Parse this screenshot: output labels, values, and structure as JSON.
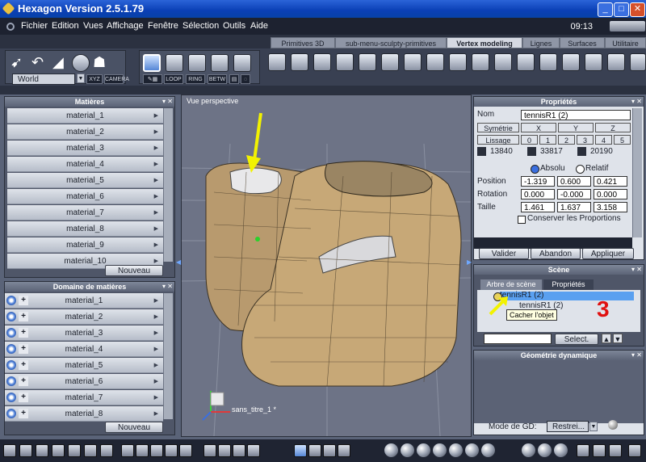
{
  "window": {
    "title": "Hexagon Version 2.5.1.79"
  },
  "menu": {
    "items": [
      "Fichier",
      "Edition",
      "Vues",
      "Affichage",
      "Fenêtre",
      "Sélection",
      "Outils",
      "Aide"
    ],
    "time": "09:13"
  },
  "tabs": [
    {
      "label": "Primitives 3D",
      "active": false
    },
    {
      "label": "sub-menu-sculpty-primitives",
      "active": false
    },
    {
      "label": "Vertex modeling",
      "active": true
    },
    {
      "label": "Lignes",
      "active": false
    },
    {
      "label": "Surfaces",
      "active": false
    },
    {
      "label": "Utilitaire",
      "active": false
    }
  ],
  "toolbar": {
    "world_select": "World",
    "xyz_label": "XYZ",
    "camera_label": "CAMERA",
    "loop_label": "LOOP",
    "ring_label": "RING",
    "betw_label": "BETW"
  },
  "viewport": {
    "label": "Vue perspective",
    "file_name": "sans_titre_1 *"
  },
  "materials_panel": {
    "title": "Matières",
    "items": [
      "material_1",
      "material_2",
      "material_3",
      "material_4",
      "material_5",
      "material_6",
      "material_7",
      "material_8",
      "material_9",
      "material_10"
    ],
    "new_button": "Nouveau"
  },
  "domain_panel": {
    "title": "Domaine de matières",
    "items": [
      "material_1",
      "material_2",
      "material_3",
      "material_4",
      "material_5",
      "material_6",
      "material_7",
      "material_8"
    ],
    "new_button": "Nouveau"
  },
  "properties_panel": {
    "title": "Propriétés",
    "name_label": "Nom",
    "name_value": "tennisR1 (2)",
    "symmetry_button": "Symétrie",
    "axis_x": "X",
    "axis_y": "Y",
    "axis_z": "Z",
    "smoothing_button": "Lissage",
    "smoothing_levels": [
      "0",
      "1",
      "2",
      "3",
      "4",
      "5"
    ],
    "counts": [
      "13840",
      "33817",
      "20190"
    ],
    "mode_absolute": "Absolu",
    "mode_relative": "Relatif",
    "position_label": "Position",
    "position": [
      "-1.319",
      "0.600",
      "0.421"
    ],
    "rotation_label": "Rotation",
    "rotation": [
      "0.000",
      "-0.000",
      "0.000"
    ],
    "size_label": "Taille",
    "size": [
      "1.461",
      "1.637",
      "3.158"
    ],
    "keep_proportions": "Conserver les Proportions",
    "validate_button": "Valider",
    "cancel_button": "Abandon",
    "apply_button": "Appliquer"
  },
  "scene_panel": {
    "title": "Scène",
    "tab_tree": "Arbre de scène",
    "tab_props": "Propriétés",
    "items": [
      "tennisR1 (2)",
      "tennisR1 (2)"
    ],
    "tooltip": "Cacher l'objet",
    "annotation": "3",
    "select_button": "Select."
  },
  "dynamic_panel": {
    "title": "Géométrie dynamique",
    "mode_label": "Mode de GD:",
    "mode_value": "Restrei..."
  },
  "colors": {
    "accent_selection": "#5aa0f0",
    "arrow": "#f2f200",
    "annotation": "#e01010"
  }
}
